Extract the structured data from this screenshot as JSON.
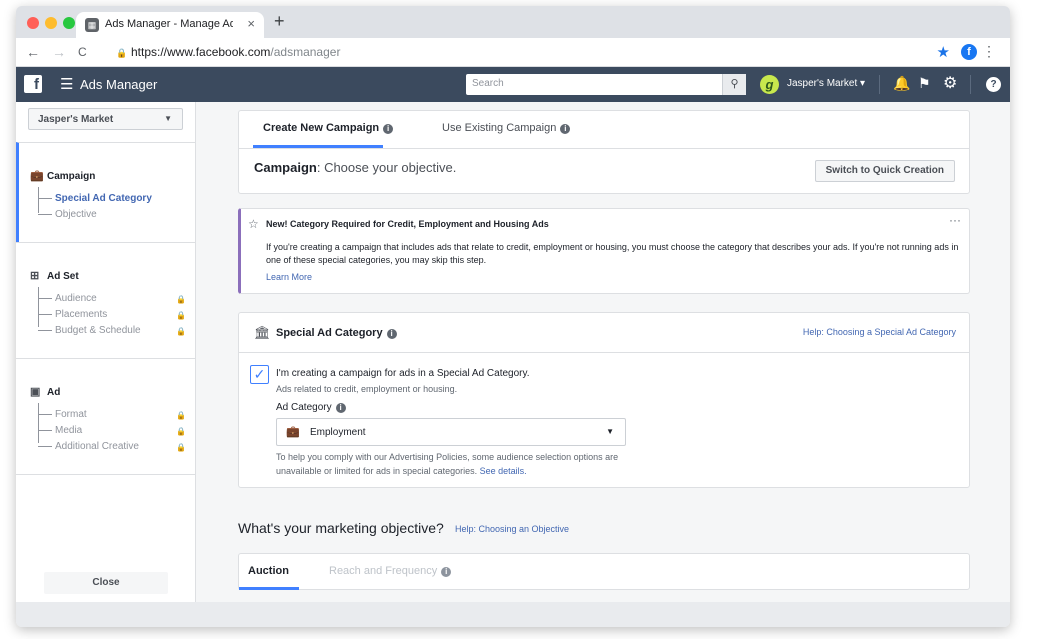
{
  "browser": {
    "tab_title": "Ads Manager - Manage Ads - I",
    "tab_close": "×",
    "new_tab": "+",
    "url_host": "https://www.facebook.com",
    "url_path": "/adsmanager",
    "nav_back": "←",
    "nav_forward": "→",
    "nav_reload": "C",
    "bookmark_star": "★",
    "extension_letter": "f",
    "menu_glyph": "⋮"
  },
  "fbnav": {
    "logo_letter": "f",
    "hamburger": "☰",
    "app_name": "Ads Manager",
    "search_placeholder": "Search",
    "search_glyph": "🔍",
    "account_avatar_letter": "g",
    "account_name": "Jasper's Market ▾"
  },
  "sidebar": {
    "account_select": "Jasper's Market",
    "sections": [
      {
        "label": "Campaign",
        "icon": "briefcase-icon",
        "items": [
          {
            "label": "Special Ad Category",
            "current": true
          },
          {
            "label": "Objective",
            "current": false
          }
        ]
      },
      {
        "label": "Ad Set",
        "icon": "grid-icon",
        "items": [
          {
            "label": "Audience"
          },
          {
            "label": "Placements"
          },
          {
            "label": "Budget & Schedule"
          }
        ]
      },
      {
        "label": "Ad",
        "icon": "monitor-icon",
        "items": [
          {
            "label": "Format"
          },
          {
            "label": "Media"
          },
          {
            "label": "Additional Creative"
          }
        ]
      }
    ],
    "close_label": "Close"
  },
  "main": {
    "tabs": [
      {
        "label": "Create New Campaign",
        "active": true
      },
      {
        "label": "Use Existing Campaign",
        "active": false
      }
    ],
    "campaign_bold": "Campaign",
    "campaign_rest": ": Choose your objective.",
    "quick_creation": "Switch to Quick Creation",
    "notice": {
      "heading": "New! Category Required for Credit, Employment and Housing Ads",
      "body": "If you're creating a campaign that includes ads that relate to credit, employment or housing, you must choose the category that describes your ads. If you're not running ads in one of these special categories, you may skip this step.",
      "learn_more": "Learn More",
      "more": "···"
    },
    "special": {
      "title": "Special Ad Category",
      "help_link": "Help: Choosing a Special Ad Category",
      "checkbox_checked": true,
      "checkbox_label": "I'm creating a campaign for ads in a Special Ad Category.",
      "checkbox_sub": "Ads related to credit, employment or housing.",
      "ad_category_label": "Ad Category",
      "ad_category_value": "Employment",
      "policy_text": "To help you comply with our Advertising Policies, some audience selection options are unavailable or limited for ads in special categories.",
      "policy_link": "See details."
    },
    "objective_title": "What's your marketing objective?",
    "objective_help": "Help: Choosing an Objective",
    "buying_tabs": [
      {
        "label": "Auction",
        "active": true
      },
      {
        "label": "Reach and Frequency",
        "active": false
      }
    ]
  }
}
